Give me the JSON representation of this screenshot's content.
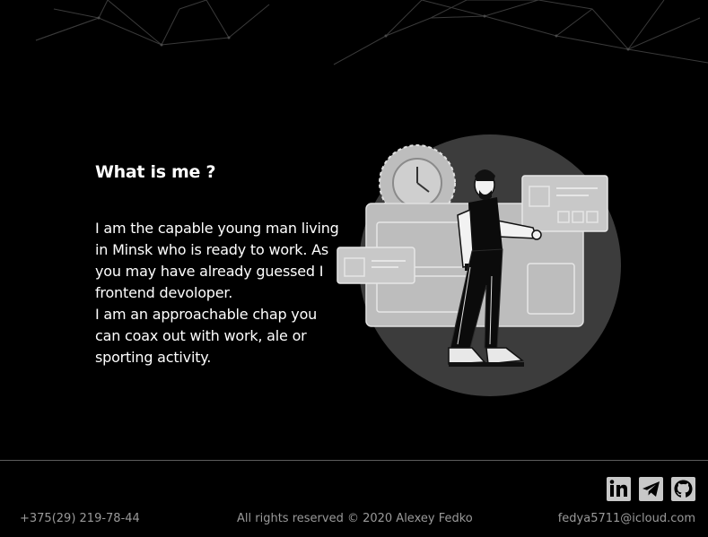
{
  "about": {
    "title": "What is me ?",
    "lines": [
      "I am the capable young man living",
      "in Minsk who is ready to work. As",
      "you may have already guessed I",
      "frontend devoloper.",
      "I am an approachable chap you",
      "can coax out with work, ale or",
      "sporting activity."
    ]
  },
  "footer": {
    "phone": "+375(29) 219-78-44",
    "copyright": "All rights reserved © 2020 Alexey Fedko",
    "email": "fedya5711@icloud.com",
    "social_icons": [
      "linkedin-icon",
      "telegram-icon",
      "github-icon"
    ]
  },
  "colors": {
    "background": "#000000",
    "text": "#ffffff",
    "footer_text": "#9a9a9a",
    "icon_fill": "#c8c8c8",
    "illustration_circle": "#3c3c3c"
  }
}
